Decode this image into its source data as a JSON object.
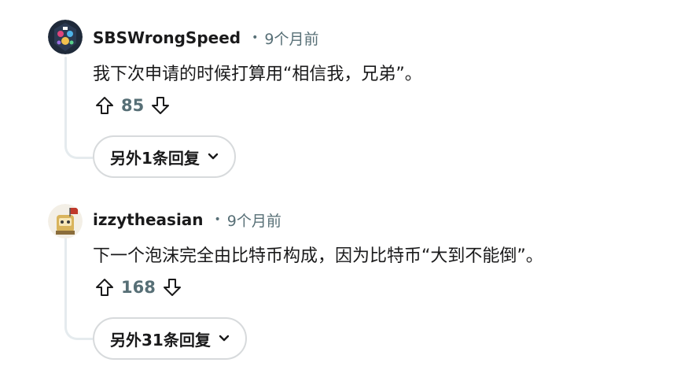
{
  "comments": [
    {
      "username": "SBSWrongSpeed",
      "separator": "•",
      "time": "9个月前",
      "text": "我下次申请的时候打算用“相信我，兄弟”。",
      "score": "85",
      "more_replies": "另外1条回复",
      "avatar_icon": "snoo-avatar-icon"
    },
    {
      "username": "izzytheasian",
      "separator": "•",
      "time": "9个月前",
      "text": "下一个泡沫完全由比特币构成，因为比特币“大到不能倒”。",
      "score": "168",
      "more_replies": "另外31条回复",
      "avatar_icon": "snoo-avatar-icon"
    }
  ]
}
